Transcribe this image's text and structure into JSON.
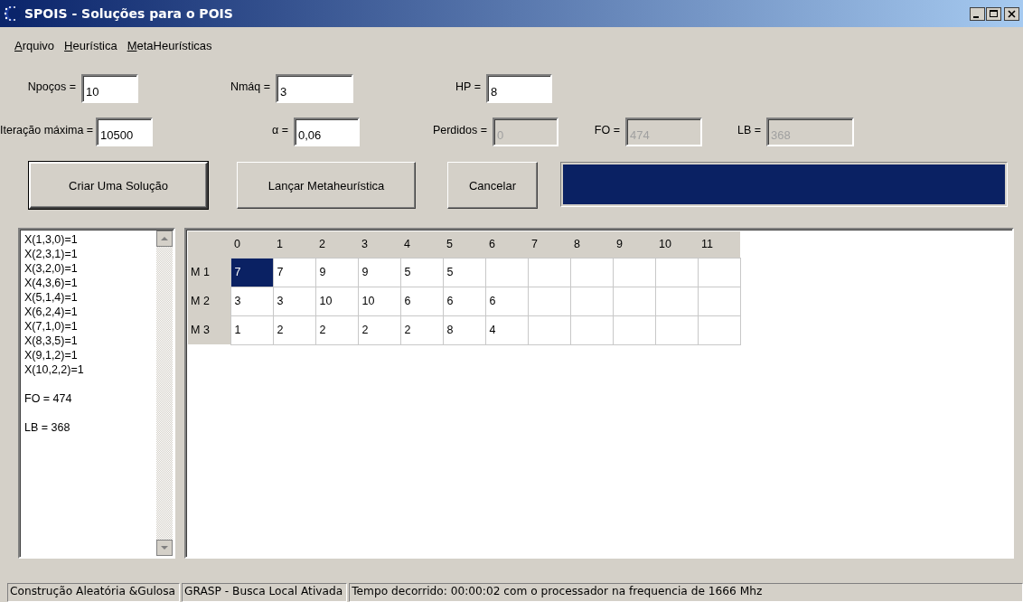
{
  "window": {
    "title": "SPOIS - Soluções para o POIS"
  },
  "menu": [
    {
      "label": "Arquivo"
    },
    {
      "label": "Heurística"
    },
    {
      "label": "MetaHeurísticas"
    }
  ],
  "parameter_rows": [
    [
      {
        "label": "Npoços =",
        "value": "10",
        "disabled": false
      },
      {
        "label": "Nmáq =",
        "value": "3",
        "disabled": false
      },
      {
        "label": "HP =",
        "value": "8",
        "disabled": false
      }
    ],
    [
      {
        "label": "Iteração máxima =",
        "value": "10500",
        "disabled": false
      },
      {
        "label": "α =",
        "value": "0,06",
        "disabled": false
      },
      {
        "label": "Perdidos =",
        "value": "0",
        "disabled": true
      },
      {
        "label": "FO =",
        "value": "474",
        "disabled": true
      },
      {
        "label": "LB =",
        "value": "368",
        "disabled": true
      }
    ]
  ],
  "buttons": [
    {
      "label": "Criar Uma Solução",
      "default": true
    },
    {
      "label": "Lançar Metaheurística",
      "default": false
    },
    {
      "label": "Cancelar",
      "default": false
    }
  ],
  "progress": {
    "level": 1
  },
  "solution_list": [
    {
      "text": "X(1,3,0)=1",
      "spaced": false
    },
    {
      "text": "X(2,3,1)=1",
      "spaced": false
    },
    {
      "text": "X(3,2,0)=1",
      "spaced": false
    },
    {
      "text": "X(4,3,6)=1",
      "spaced": false
    },
    {
      "text": "X(5,1,4)=1",
      "spaced": false
    },
    {
      "text": "X(6,2,4)=1",
      "spaced": false
    },
    {
      "text": "X(7,1,0)=1",
      "spaced": false
    },
    {
      "text": "X(8,3,5)=1",
      "spaced": false
    },
    {
      "text": "X(9,1,2)=1",
      "spaced": false
    },
    {
      "text": "X(10,2,2)=1",
      "spaced": false
    },
    {
      "text": "FO = 474",
      "spaced": true
    },
    {
      "text": "LB = 368",
      "spaced": true
    }
  ],
  "grid": {
    "columns": [
      "0",
      "1",
      "2",
      "3",
      "4",
      "5",
      "6",
      "7",
      "8",
      "9",
      "10",
      "11"
    ],
    "rows": [
      {
        "label": "M 1",
        "cells": [
          {
            "value": "7",
            "selected": true
          },
          {
            "value": "7",
            "selected": false
          },
          {
            "value": "9",
            "selected": false
          },
          {
            "value": "9",
            "selected": false
          },
          {
            "value": "5",
            "selected": false
          },
          {
            "value": "5",
            "selected": false
          }
        ]
      },
      {
        "label": "M 2",
        "cells": [
          {
            "value": "3",
            "selected": false
          },
          {
            "value": "3",
            "selected": false
          },
          {
            "value": "10",
            "selected": false
          },
          {
            "value": "10",
            "selected": false
          },
          {
            "value": "6",
            "selected": false
          },
          {
            "value": "6",
            "selected": false
          },
          {
            "value": "6",
            "selected": false
          }
        ]
      },
      {
        "label": "M 3",
        "cells": [
          {
            "value": "1",
            "selected": false
          },
          {
            "value": "2",
            "selected": false
          },
          {
            "value": "2",
            "selected": false
          },
          {
            "value": "2",
            "selected": false
          },
          {
            "value": "2",
            "selected": false
          },
          {
            "value": "8",
            "selected": false
          },
          {
            "value": "4",
            "selected": false
          }
        ]
      }
    ]
  },
  "status_bar": [
    "Construção Aleatória &Gulosa",
    "GRASP - Busca Local Ativada",
    "Tempo decorrido: 00:00:02 com o processador na frequencia de 1666 Mhz"
  ]
}
